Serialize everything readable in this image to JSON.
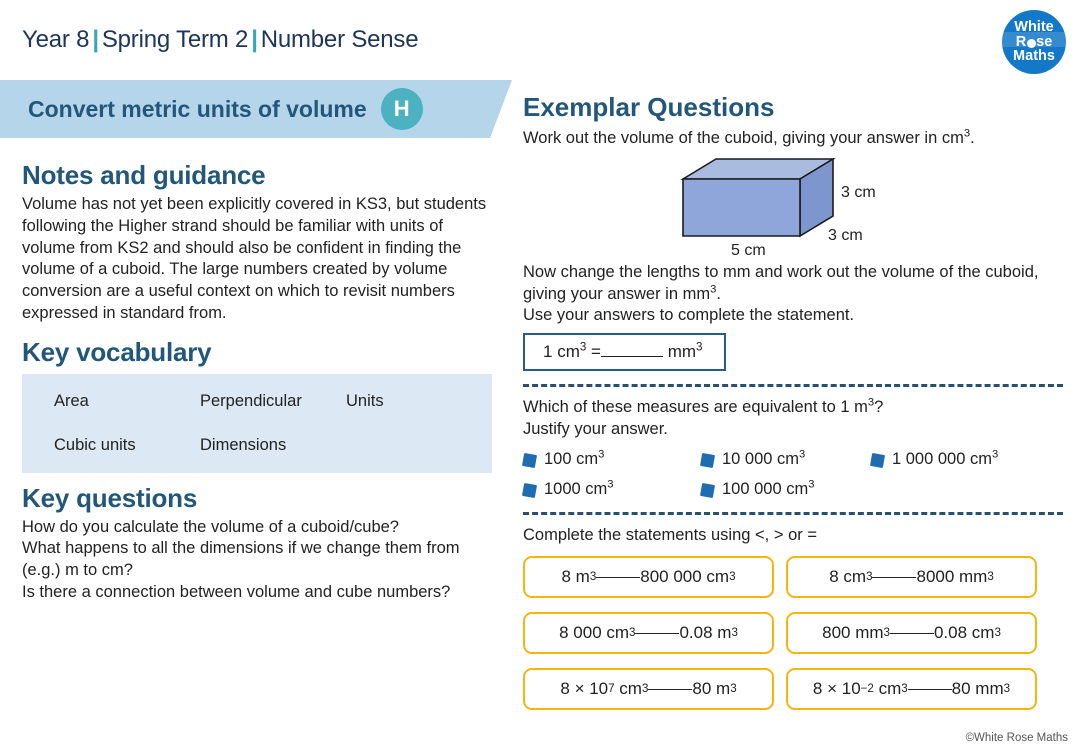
{
  "header": {
    "year": "Year 8",
    "term": "Spring Term 2",
    "topic": "Number Sense",
    "separator": "|"
  },
  "logo": {
    "line1": "White",
    "line2_before": "R",
    "line2_after": "se",
    "line3": "Maths"
  },
  "banner": {
    "title": "Convert metric units of volume",
    "badge": "H"
  },
  "notes": {
    "heading": "Notes and guidance",
    "body": "Volume has not yet been explicitly covered in KS3, but students following the Higher strand should be familiar with units of volume from KS2 and should also be confident in finding the volume of a cuboid. The large numbers created by volume conversion are a useful context on which to revisit numbers expressed in standard from."
  },
  "vocabulary": {
    "heading": "Key vocabulary",
    "row1": {
      "c1": "Area",
      "c2": "Perpendicular",
      "c3": "Units"
    },
    "row2": {
      "c1": "Cubic units",
      "c2": "Dimensions",
      "c3": ""
    }
  },
  "questions": {
    "heading": "Key questions",
    "q1": "How do you calculate the volume of a cuboid/cube?",
    "q2": "What happens to all the dimensions if we change them from (e.g.) m to cm?",
    "q3": "Is there a connection between volume and cube numbers?"
  },
  "exemplar": {
    "heading": "Exemplar Questions",
    "prompt1_a": "Work out the volume of the cuboid, giving your answer in cm",
    "prompt1_sup": "3",
    "prompt1_b": ".",
    "cuboid": {
      "height_label": "3 cm",
      "depth_label": "3 cm",
      "width_label": "5 cm",
      "front_color": "#8ea6da",
      "top_color": "#a9bce0",
      "side_color": "#7d96cd",
      "edge_color": "#1a1a1a"
    },
    "prompt2_a": "Now change the lengths to mm and work out the volume of the cuboid, giving your answer in mm",
    "prompt2_sup": "3",
    "prompt2_b": ".",
    "prompt3": "Use your answers to complete the statement.",
    "blue_box": {
      "left_num": "1",
      "left_unit": "cm",
      "left_sup": "3",
      "equals": "=",
      "right_unit": "mm",
      "right_sup": "3"
    },
    "prompt4_a": "Which of these measures are equivalent to 1 m",
    "prompt4_sup": "3",
    "prompt4_b": "?",
    "prompt5": "Justify your answer.",
    "options": [
      {
        "value": "100 cm",
        "sup": "3"
      },
      {
        "value": "10 000 cm",
        "sup": "3"
      },
      {
        "value": "1 000 000 cm",
        "sup": "3"
      },
      {
        "value": "1000 cm",
        "sup": "3"
      },
      {
        "value": "100 000 cm",
        "sup": "3"
      }
    ],
    "prompt6": "Complete the statements using <, > or =",
    "statements": [
      {
        "left": "8 m",
        "left_sup": "3",
        "right": "800 000 cm",
        "right_sup": "3"
      },
      {
        "left": "8 cm",
        "left_sup": "3",
        "right": "8000 mm",
        "right_sup": "3"
      },
      {
        "left": "8 000 cm",
        "left_sup": "3",
        "right": "0.08 m",
        "right_sup": "3"
      },
      {
        "left": "800 mm",
        "left_sup": "3",
        "right": "0.08 cm",
        "right_sup": "3"
      },
      {
        "left": "8 × 10",
        "left_exp": "7",
        "left_unit": "cm",
        "left_sup": "3",
        "right": "80 m",
        "right_sup": "3"
      },
      {
        "left": "8 × 10",
        "left_exp": "−2",
        "left_unit": "cm",
        "left_sup": "3",
        "right": "80 mm",
        "right_sup": "3"
      }
    ]
  },
  "footer": "©White Rose Maths",
  "colors": {
    "navy": "#22577a",
    "teal": "#4cb2c2",
    "banner_blue": "#b4d5ea",
    "vocab_blue": "#dce8f3",
    "yellow": "#f5b511",
    "logo_blue": "#1478c8",
    "dash_blue": "#2a5070"
  }
}
